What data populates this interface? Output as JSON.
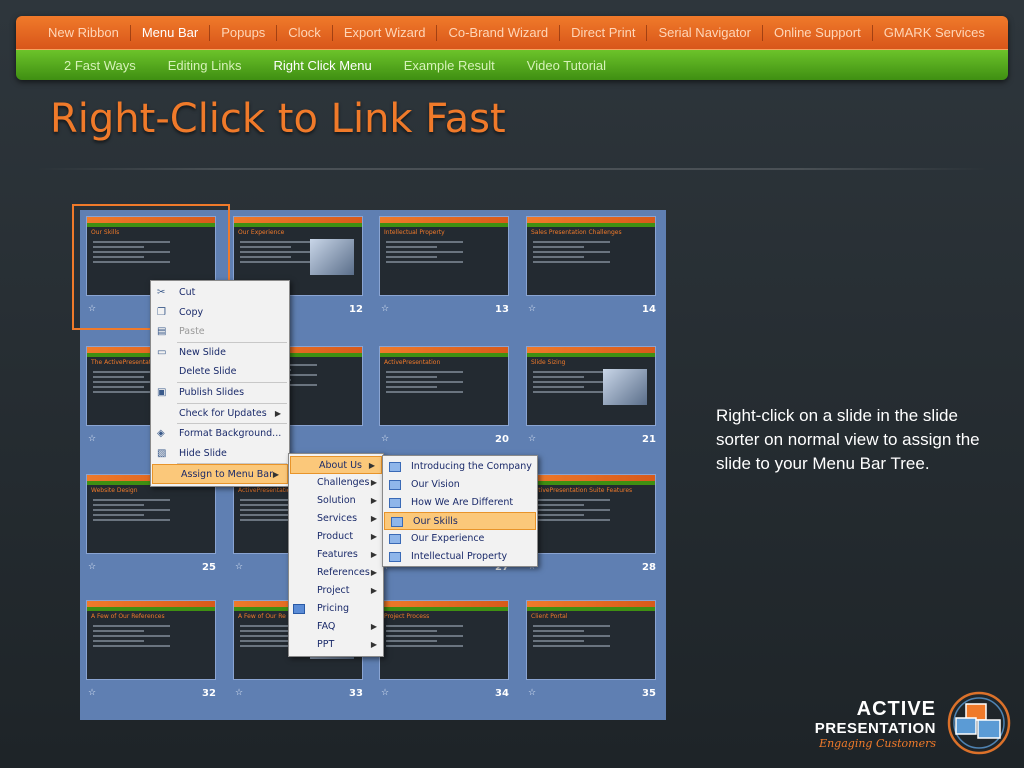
{
  "nav": {
    "top": [
      "New Ribbon",
      "Menu Bar",
      "Popups",
      "Clock",
      "Export Wizard",
      "Co-Brand Wizard",
      "Direct Print",
      "Serial Navigator",
      "Online Support",
      "GMARK Services"
    ],
    "top_active": "Menu Bar",
    "bottom": [
      "2 Fast Ways",
      "Editing Links",
      "Right Click Menu",
      "Example Result",
      "Video Tutorial"
    ],
    "bottom_active": "Right Click Menu"
  },
  "title": "Right-Click to Link Fast",
  "description": "Right-click on a slide in the slide sorter on normal view to assign the slide to your Menu Bar Tree.",
  "slides": [
    {
      "title": "Our Skills",
      "num": ""
    },
    {
      "title": "Our Experience",
      "num": "12"
    },
    {
      "title": "Intellectual Property",
      "num": "13"
    },
    {
      "title": "Sales Presentation Challenges",
      "num": "14"
    },
    {
      "title": "The ActivePresentation",
      "num": ""
    },
    {
      "title": "",
      "num": ""
    },
    {
      "title": "ActivePresentation",
      "num": "20"
    },
    {
      "title": "Slide Sizing",
      "num": "21"
    },
    {
      "title": "Website Design",
      "num": "25"
    },
    {
      "title": "ActivePresentation",
      "num": ""
    },
    {
      "title": "",
      "num": "27"
    },
    {
      "title": "ActivePresentation Suite Features",
      "num": "28"
    },
    {
      "title": "A Few of Our References",
      "num": "32"
    },
    {
      "title": "A Few of Our Re",
      "num": "33"
    },
    {
      "title": "Project Process",
      "num": "34"
    },
    {
      "title": "Client Portal",
      "num": "35"
    }
  ],
  "context_menu": [
    {
      "label": "Cut",
      "icon": "scissors-icon",
      "disabled": false
    },
    {
      "label": "Copy",
      "icon": "copy-icon",
      "disabled": false
    },
    {
      "label": "Paste",
      "icon": "paste-icon",
      "disabled": true
    },
    {
      "label": "New Slide",
      "icon": "new-slide-icon",
      "disabled": false
    },
    {
      "label": "Delete Slide",
      "icon": "",
      "disabled": false
    },
    {
      "label": "Publish Slides",
      "icon": "publish-icon",
      "disabled": false
    },
    {
      "label": "Check for Updates",
      "icon": "",
      "disabled": false,
      "submenu": true
    },
    {
      "label": "Format Background...",
      "icon": "format-background-icon",
      "disabled": false
    },
    {
      "label": "Hide Slide",
      "icon": "hide-slide-icon",
      "disabled": false
    },
    {
      "label": "Assign to Menu Bar",
      "icon": "",
      "disabled": false,
      "submenu": true,
      "highlight": true
    }
  ],
  "submenu_1": [
    "About Us",
    "Challenges",
    "Solution",
    "Services",
    "Product",
    "Features",
    "References",
    "Project",
    "Pricing",
    "FAQ",
    "PPT"
  ],
  "submenu_1_active": "About Us",
  "submenu_2": [
    "Introducing the Company",
    "Our Vision",
    "How We Are Different",
    "Our Skills",
    "Our Experience",
    "Intellectual Property"
  ],
  "submenu_2_active": "Our Skills",
  "logo": {
    "line1": "ACTIVE",
    "line2": "PRESENTATION",
    "tagline": "Engaging Customers"
  },
  "colors": {
    "accent_orange": "#f07a2a",
    "nav_green": "#4ea51a",
    "sorter_blue": "#5f7fb2"
  }
}
